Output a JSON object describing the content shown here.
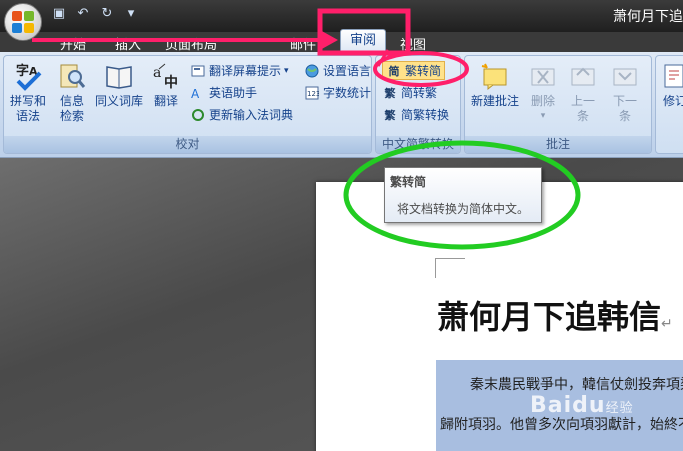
{
  "window": {
    "title": "萧何月下追"
  },
  "quick_access": {
    "save": "💾",
    "undo": "↶",
    "redo": "↻",
    "more": "▾"
  },
  "tabs": [
    {
      "label": "开始"
    },
    {
      "label": "插入"
    },
    {
      "label": "页面布局"
    },
    {
      "label": "邮件"
    },
    {
      "label": "审阅",
      "active": true
    },
    {
      "label": "视图"
    }
  ],
  "groups": {
    "proofing": {
      "label": "校对",
      "spelling": "拼写和\n语法",
      "spelling_l1": "拼写和",
      "spelling_l2": "语法",
      "research_l1": "信息",
      "research_l2": "检索",
      "thesaurus": "同义词库",
      "translate": "翻译",
      "translate_tip": "翻译屏幕提示",
      "english_assistant": "英语助手",
      "update_ime": "更新输入法词典",
      "set_language": "设置语言",
      "word_count": "字数统计"
    },
    "chinese_conversion": {
      "label": "中文简繁转换",
      "trad_to_simp": "繁转简",
      "simp_to_trad": "简转繁",
      "convert": "简繁转换"
    },
    "comments": {
      "label": "批注",
      "new_comment": "新建批注",
      "delete": "删除",
      "prev_l1": "上一",
      "prev_l2": "条",
      "next_l1": "下一",
      "next_l2": "条"
    },
    "tracking": {
      "track_l1": "修订"
    }
  },
  "tooltip": {
    "title": "繁转简",
    "body": "将文档转换为简体中文。"
  },
  "document": {
    "title": "萧何月下追韩信",
    "line1": "秦末農民戰爭中，韓信仗劍投奔項梁",
    "line2": "歸附項羽。他曾多次向項羽獻計，始終不"
  },
  "watermark": {
    "brand": "Baidu",
    "suffix": "经验"
  },
  "colors": {
    "highlight_pink": "#ff1f6a",
    "highlight_green": "#22cc22",
    "selection": "#a8bee0"
  }
}
